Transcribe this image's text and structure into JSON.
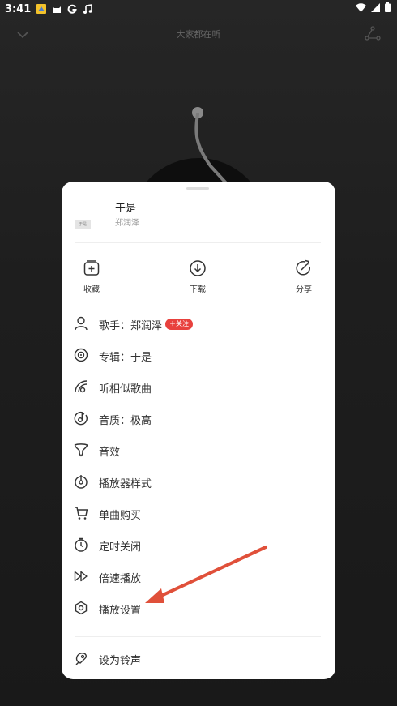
{
  "status_bar": {
    "time": "3:41",
    "icons": [
      "notification-icon",
      "cat-icon",
      "g-icon",
      "music-note-icon"
    ]
  },
  "top_bar": {
    "title": "大家都在听"
  },
  "song": {
    "title": "于是",
    "artist": "郑润泽",
    "cover_text": "于是"
  },
  "actions": [
    {
      "label": "收藏",
      "icon": "add-favorite-icon"
    },
    {
      "label": "下载",
      "icon": "download-icon"
    },
    {
      "label": "分享",
      "icon": "share-icon"
    }
  ],
  "menu": [
    {
      "label": "歌手：郑润泽",
      "icon": "singer-icon",
      "badge": "＋关注"
    },
    {
      "label": "专辑：于是",
      "icon": "album-icon"
    },
    {
      "label": "听相似歌曲",
      "icon": "similar-songs-icon"
    },
    {
      "label": "音质：极高",
      "icon": "quality-icon"
    },
    {
      "label": "音效",
      "icon": "sound-effect-icon"
    },
    {
      "label": "播放器样式",
      "icon": "player-style-icon"
    },
    {
      "label": "单曲购买",
      "icon": "cart-icon"
    },
    {
      "label": "定时关闭",
      "icon": "timer-icon"
    },
    {
      "label": "倍速播放",
      "icon": "speed-icon"
    },
    {
      "label": "播放设置",
      "icon": "settings-icon"
    },
    {
      "label": "设为铃声",
      "icon": "ringtone-icon"
    }
  ],
  "colors": {
    "accent": "#e8413d",
    "annotation_arrow": "#e0503a",
    "sheet_bg": "#ffffff",
    "background": "#1e1e1e"
  }
}
